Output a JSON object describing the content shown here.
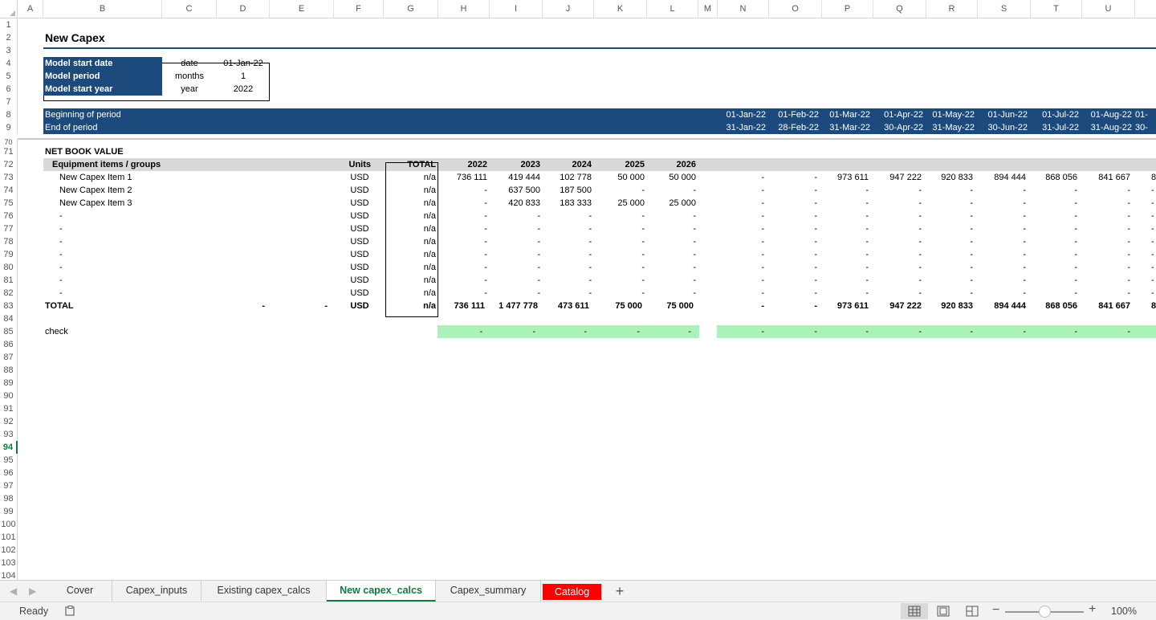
{
  "columns": [
    "A",
    "B",
    "C",
    "D",
    "E",
    "F",
    "G",
    "H",
    "I",
    "J",
    "K",
    "L",
    "M",
    "N",
    "O",
    "P",
    "Q",
    "R",
    "S",
    "T",
    "U"
  ],
  "title": "New Capex",
  "info": [
    {
      "label": "Model start date",
      "unit": "date",
      "value": "01-Jan-22"
    },
    {
      "label": "Model period",
      "unit": "months",
      "value": "1"
    },
    {
      "label": "Model start year",
      "unit": "year",
      "value": "2022"
    }
  ],
  "period_labels": {
    "begin": "Beginning of period",
    "end": "End of period"
  },
  "period_begin": [
    "01-Jan-22",
    "01-Feb-22",
    "01-Mar-22",
    "01-Apr-22",
    "01-May-22",
    "01-Jun-22",
    "01-Jul-22",
    "01-Aug-22",
    "01-"
  ],
  "period_end": [
    "31-Jan-22",
    "28-Feb-22",
    "31-Mar-22",
    "30-Apr-22",
    "31-May-22",
    "30-Jun-22",
    "31-Jul-22",
    "31-Aug-22",
    "30-"
  ],
  "section_title": "NET BOOK VALUE",
  "table_header": {
    "group": "Equipment items / groups",
    "units": "Units",
    "total": "TOTAL",
    "years": [
      "2022",
      "2023",
      "2024",
      "2025",
      "2026"
    ]
  },
  "items": [
    {
      "name": "New Capex Item 1",
      "units": "USD",
      "total": "n/a",
      "years": [
        "736 111",
        "419 444",
        "102 778",
        "50 000",
        "50 000"
      ],
      "months": [
        "-",
        "-",
        "973 611",
        "947 222",
        "920 833",
        "894 444",
        "868 056",
        "841 667",
        "8"
      ]
    },
    {
      "name": "New Capex Item 2",
      "units": "USD",
      "total": "n/a",
      "years": [
        "-",
        "637 500",
        "187 500",
        "-",
        "-"
      ],
      "months": [
        "-",
        "-",
        "-",
        "-",
        "-",
        "-",
        "-",
        "-",
        "-"
      ]
    },
    {
      "name": "New Capex Item 3",
      "units": "USD",
      "total": "n/a",
      "years": [
        "-",
        "420 833",
        "183 333",
        "25 000",
        "25 000"
      ],
      "months": [
        "-",
        "-",
        "-",
        "-",
        "-",
        "-",
        "-",
        "-",
        "-"
      ]
    },
    {
      "name": "-",
      "units": "USD",
      "total": "n/a",
      "years": [
        "-",
        "-",
        "-",
        "-",
        "-"
      ],
      "months": [
        "-",
        "-",
        "-",
        "-",
        "-",
        "-",
        "-",
        "-",
        "-"
      ]
    },
    {
      "name": "-",
      "units": "USD",
      "total": "n/a",
      "years": [
        "-",
        "-",
        "-",
        "-",
        "-"
      ],
      "months": [
        "-",
        "-",
        "-",
        "-",
        "-",
        "-",
        "-",
        "-",
        "-"
      ]
    },
    {
      "name": "-",
      "units": "USD",
      "total": "n/a",
      "years": [
        "-",
        "-",
        "-",
        "-",
        "-"
      ],
      "months": [
        "-",
        "-",
        "-",
        "-",
        "-",
        "-",
        "-",
        "-",
        "-"
      ]
    },
    {
      "name": "-",
      "units": "USD",
      "total": "n/a",
      "years": [
        "-",
        "-",
        "-",
        "-",
        "-"
      ],
      "months": [
        "-",
        "-",
        "-",
        "-",
        "-",
        "-",
        "-",
        "-",
        "-"
      ]
    },
    {
      "name": "-",
      "units": "USD",
      "total": "n/a",
      "years": [
        "-",
        "-",
        "-",
        "-",
        "-"
      ],
      "months": [
        "-",
        "-",
        "-",
        "-",
        "-",
        "-",
        "-",
        "-",
        "-"
      ]
    },
    {
      "name": "-",
      "units": "USD",
      "total": "n/a",
      "years": [
        "-",
        "-",
        "-",
        "-",
        "-"
      ],
      "months": [
        "-",
        "-",
        "-",
        "-",
        "-",
        "-",
        "-",
        "-",
        "-"
      ]
    },
    {
      "name": "-",
      "units": "USD",
      "total": "n/a",
      "years": [
        "-",
        "-",
        "-",
        "-",
        "-"
      ],
      "months": [
        "-",
        "-",
        "-",
        "-",
        "-",
        "-",
        "-",
        "-",
        "-"
      ]
    }
  ],
  "total_row": {
    "label": "TOTAL",
    "d": "-",
    "e": "-",
    "units": "USD",
    "total": "n/a",
    "years": [
      "736 111",
      "1 477 778",
      "473 611",
      "75 000",
      "75 000"
    ],
    "months": [
      "-",
      "-",
      "973 611",
      "947 222",
      "920 833",
      "894 444",
      "868 056",
      "841 667",
      "8"
    ]
  },
  "check_row": {
    "label": "check",
    "years": [
      "-",
      "-",
      "-",
      "-",
      "-"
    ],
    "months": [
      "-",
      "-",
      "-",
      "-",
      "-",
      "-",
      "-",
      "-"
    ]
  },
  "row_numbers": [
    "1",
    "2",
    "3",
    "4",
    "5",
    "6",
    "7",
    "8",
    "9",
    "70",
    "71",
    "72",
    "73",
    "74",
    "75",
    "76",
    "77",
    "78",
    "79",
    "80",
    "81",
    "82",
    "83",
    "84",
    "85",
    "86",
    "87",
    "88",
    "89",
    "90",
    "91",
    "92",
    "93",
    "94",
    "95",
    "96",
    "97",
    "98",
    "99",
    "100",
    "101",
    "102",
    "103",
    "104"
  ],
  "active_row": "94",
  "tabs": [
    "Cover",
    "Capex_inputs",
    "Existing capex_calcs",
    "New capex_calcs",
    "Capex_summary",
    "Catalog"
  ],
  "active_tab": "New capex_calcs",
  "add_tab": "+",
  "status": {
    "ready": "Ready",
    "zoom": "100%",
    "zoom_level": 1.0
  }
}
